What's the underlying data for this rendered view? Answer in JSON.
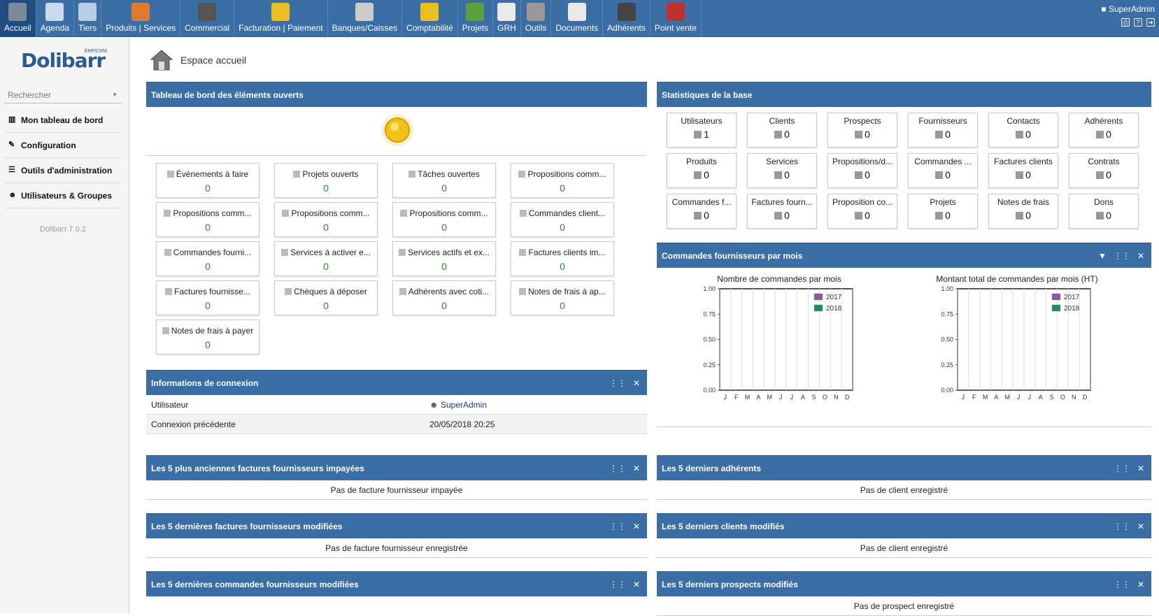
{
  "menu": [
    {
      "label": "Accueil",
      "icon": "home-icon",
      "color": "#7a8a9a"
    },
    {
      "label": "Agenda",
      "icon": "calendar-icon",
      "color": "#c9d9ee"
    },
    {
      "label": "Tiers",
      "icon": "building-icon",
      "color": "#b8cce4"
    },
    {
      "label": "Produits | Services",
      "icon": "box-icon",
      "color": "#e07a2e"
    },
    {
      "label": "Commercial",
      "icon": "people-icon",
      "color": "#555"
    },
    {
      "label": "Facturation | Paiement",
      "icon": "coins-icon",
      "color": "#e8c020"
    },
    {
      "label": "Banques/Caisses",
      "icon": "safe-icon",
      "color": "#ccc"
    },
    {
      "label": "Comptabilité",
      "icon": "coins-icon",
      "color": "#e8c020"
    },
    {
      "label": "Projets",
      "icon": "folder-icon",
      "color": "#5aa040"
    },
    {
      "label": "GRH",
      "icon": "document-icon",
      "color": "#e9e9e9"
    },
    {
      "label": "Outils",
      "icon": "tools-icon",
      "color": "#999"
    },
    {
      "label": "Documents",
      "icon": "file-icon",
      "color": "#e9e9e9"
    },
    {
      "label": "Adhérents",
      "icon": "group-icon",
      "color": "#444"
    },
    {
      "label": "Point vente",
      "icon": "shop-icon",
      "color": "#c03030"
    }
  ],
  "user": {
    "name": "SuperAdmin"
  },
  "sidebar": {
    "logo": "Dolibarr",
    "logo_sub": "ERP/CRM",
    "search_placeholder": "Rechercher",
    "items": [
      {
        "label": "Mon tableau de bord",
        "icon": "chart-icon",
        "glyph": "▥"
      },
      {
        "label": "Configuration",
        "icon": "wrench-icon",
        "glyph": "✎"
      },
      {
        "label": "Outils d'administration",
        "icon": "toolbox-icon",
        "glyph": "☰"
      },
      {
        "label": "Utilisateurs & Groupes",
        "icon": "users-icon",
        "glyph": "☻"
      }
    ],
    "version": "Dolibarr 7.0.2"
  },
  "page_title": "Espace accueil",
  "board": {
    "title": "Tableau de bord des éléments ouverts",
    "items": [
      {
        "label": "Événements à faire",
        "value": "0"
      },
      {
        "label": "Projets ouverts",
        "value": "0"
      },
      {
        "label": "Tâches ouvertes",
        "value": "0"
      },
      {
        "label": "Propositions comm...",
        "value": "0"
      },
      {
        "label": "Propositions comm...",
        "value": "0"
      },
      {
        "label": "Propositions comm...",
        "value": "0"
      },
      {
        "label": "Propositions comm...",
        "value": "0"
      },
      {
        "label": "Commandes client...",
        "value": "0"
      },
      {
        "label": "Commandes fourni...",
        "value": "0"
      },
      {
        "label": "Services à activer e...",
        "value": "0"
      },
      {
        "label": "Services actifs et ex...",
        "value": "0"
      },
      {
        "label": "Factures clients im...",
        "value": "0"
      },
      {
        "label": "Factures fournisse...",
        "value": "0"
      },
      {
        "label": "Chèques à déposer",
        "value": "0"
      },
      {
        "label": "Adhérents avec coti...",
        "value": "0"
      },
      {
        "label": "Notes de frais à ap...",
        "value": "0"
      },
      {
        "label": "Notes de frais à payer",
        "value": "0"
      }
    ]
  },
  "stats": {
    "title": "Statistiques de la base",
    "items": [
      {
        "label": "Utilisateurs",
        "value": "1"
      },
      {
        "label": "Clients",
        "value": "0"
      },
      {
        "label": "Prospects",
        "value": "0"
      },
      {
        "label": "Fournisseurs",
        "value": "0"
      },
      {
        "label": "Contacts",
        "value": "0"
      },
      {
        "label": "Adhérents",
        "value": "0"
      },
      {
        "label": "Produits",
        "value": "0"
      },
      {
        "label": "Services",
        "value": "0"
      },
      {
        "label": "Propositions/d...",
        "value": "0"
      },
      {
        "label": "Commandes ...",
        "value": "0"
      },
      {
        "label": "Factures clients",
        "value": "0"
      },
      {
        "label": "Contrats",
        "value": "0"
      },
      {
        "label": "Commandes f...",
        "value": "0"
      },
      {
        "label": "Factures fourn...",
        "value": "0"
      },
      {
        "label": "Proposition co...",
        "value": "0"
      },
      {
        "label": "Projets",
        "value": "0"
      },
      {
        "label": "Notes de frais",
        "value": "0"
      },
      {
        "label": "Dons",
        "value": "0"
      }
    ]
  },
  "connexion": {
    "title": "Informations de connexion",
    "rows": [
      {
        "key": "Utilisateur",
        "value": "SuperAdmin"
      },
      {
        "key": "Connexion précédente",
        "value": "20/05/2018 20:25"
      }
    ]
  },
  "blocks_left": [
    {
      "title": "Les 5 plus anciennes factures fournisseurs impayées",
      "empty": "Pas de facture fournisseur impayée"
    },
    {
      "title": "Les 5 dernières factures fournisseurs modifiées",
      "empty": "Pas de facture fournisseur enregistrée"
    },
    {
      "title": "Les 5 dernières commandes fournisseurs modifiées",
      "empty": ""
    }
  ],
  "blocks_right": [
    {
      "title": "Les 5 derniers adhérents",
      "empty": "Pas de client enregistré"
    },
    {
      "title": "Les 5 derniers clients modifiés",
      "empty": "Pas de client enregistré"
    },
    {
      "title": "Les 5 derniers prospects modifiés",
      "empty": "Pas de prospect enregistré"
    }
  ],
  "orders_panel": {
    "title": "Commandes fournisseurs par mois"
  },
  "chart_data": [
    {
      "type": "bar",
      "title": "Nombre de commandes par mois",
      "categories": [
        "J",
        "F",
        "M",
        "A",
        "M",
        "J",
        "J",
        "A",
        "S",
        "O",
        "N",
        "D"
      ],
      "series": [
        {
          "name": "2017",
          "values": [
            0,
            0,
            0,
            0,
            0,
            0,
            0,
            0,
            0,
            0,
            0,
            0
          ],
          "color": "#8a5a9a"
        },
        {
          "name": "2018",
          "values": [
            0,
            0,
            0,
            0,
            0,
            0,
            0,
            0,
            0,
            0,
            0,
            0
          ],
          "color": "#1a8a6a"
        }
      ],
      "yticks": [
        "0.00",
        "0.25",
        "0.50",
        "0.75",
        "1.00"
      ],
      "ylim": [
        0,
        1
      ],
      "grid": true,
      "legend": "top-right"
    },
    {
      "type": "bar",
      "title": "Montant total de commandes par mois (HT)",
      "categories": [
        "J",
        "F",
        "M",
        "A",
        "M",
        "J",
        "J",
        "A",
        "S",
        "O",
        "N",
        "D"
      ],
      "series": [
        {
          "name": "2017",
          "values": [
            0,
            0,
            0,
            0,
            0,
            0,
            0,
            0,
            0,
            0,
            0,
            0
          ],
          "color": "#8a5a9a"
        },
        {
          "name": "2018",
          "values": [
            0,
            0,
            0,
            0,
            0,
            0,
            0,
            0,
            0,
            0,
            0,
            0
          ],
          "color": "#1a8a6a"
        }
      ],
      "yticks": [
        "0.00",
        "0.25",
        "0.50",
        "0.75",
        "1.00"
      ],
      "ylim": [
        0,
        1
      ],
      "grid": true,
      "legend": "top-right"
    }
  ],
  "colors": {
    "accent": "#3b6ea5",
    "value_green": "#2a8a2a"
  }
}
